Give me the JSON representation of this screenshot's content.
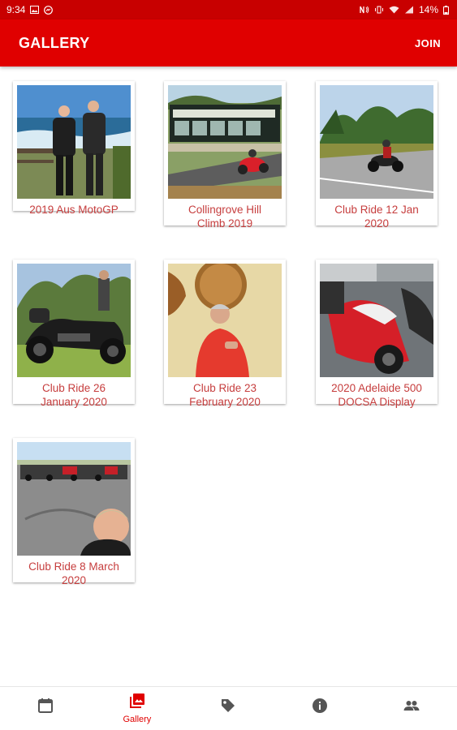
{
  "status_bar": {
    "time": "9:34",
    "battery": "14%",
    "icons": [
      "image-icon",
      "messenger-icon",
      "nfc-icon",
      "vibrate-icon",
      "wifi-icon",
      "signal-icon",
      "battery-icon"
    ]
  },
  "app_bar": {
    "title": "GALLERY",
    "join_label": "JOIN"
  },
  "gallery": {
    "albums": [
      {
        "line1": "2019 Aus MotoGP",
        "line2": ""
      },
      {
        "line1": "Collingrove Hill",
        "line2": "Climb 2019"
      },
      {
        "line1": "Club Ride 12 Jan",
        "line2": "2020"
      },
      {
        "line1": "Club Ride 26",
        "line2": "January 2020"
      },
      {
        "line1": "Club Ride 23",
        "line2": "February 2020"
      },
      {
        "line1": "2020 Adelaide 500",
        "line2": "DOCSA Display"
      },
      {
        "line1": "Club Ride 8 March",
        "line2": "2020"
      }
    ]
  },
  "bottom_nav": {
    "items": [
      {
        "icon": "calendar-icon",
        "label": ""
      },
      {
        "icon": "gallery-icon",
        "label": "Gallery"
      },
      {
        "icon": "tag-icon",
        "label": ""
      },
      {
        "icon": "info-icon",
        "label": ""
      },
      {
        "icon": "people-icon",
        "label": ""
      }
    ],
    "active_index": 1
  },
  "colors": {
    "status_bar": "#c80000",
    "app_bar": "#e00000",
    "caption_text": "#c63d3d",
    "nav_active": "#e00000",
    "nav_inactive": "#555555"
  }
}
